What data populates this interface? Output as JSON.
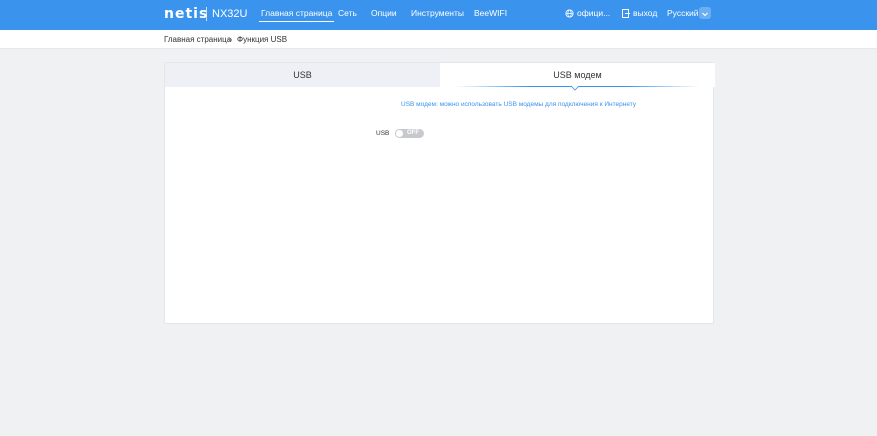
{
  "header": {
    "brand": "netis",
    "model": "NX32U",
    "nav": [
      {
        "label": "Главная страница",
        "active": true
      },
      {
        "label": "Сеть"
      },
      {
        "label": "Опции"
      },
      {
        "label": "Инструменты"
      },
      {
        "label": "BeeWIFI"
      }
    ],
    "official_label": "офици...",
    "logout_label": "выход",
    "language": "Русский"
  },
  "breadcrumb": {
    "home": "Главная страница",
    "separator": "»",
    "current": "Функция USB"
  },
  "tabs": [
    {
      "label": "USB",
      "active": false
    },
    {
      "label": "USB модем",
      "active": true
    }
  ],
  "content": {
    "hint": "USB модем: можно использовать USB модемы для подключения к Интернету",
    "usb_label": "USB",
    "usb_toggle": "OFF"
  },
  "colors": {
    "accent": "#3a94ee",
    "background": "#f0f1f3"
  }
}
